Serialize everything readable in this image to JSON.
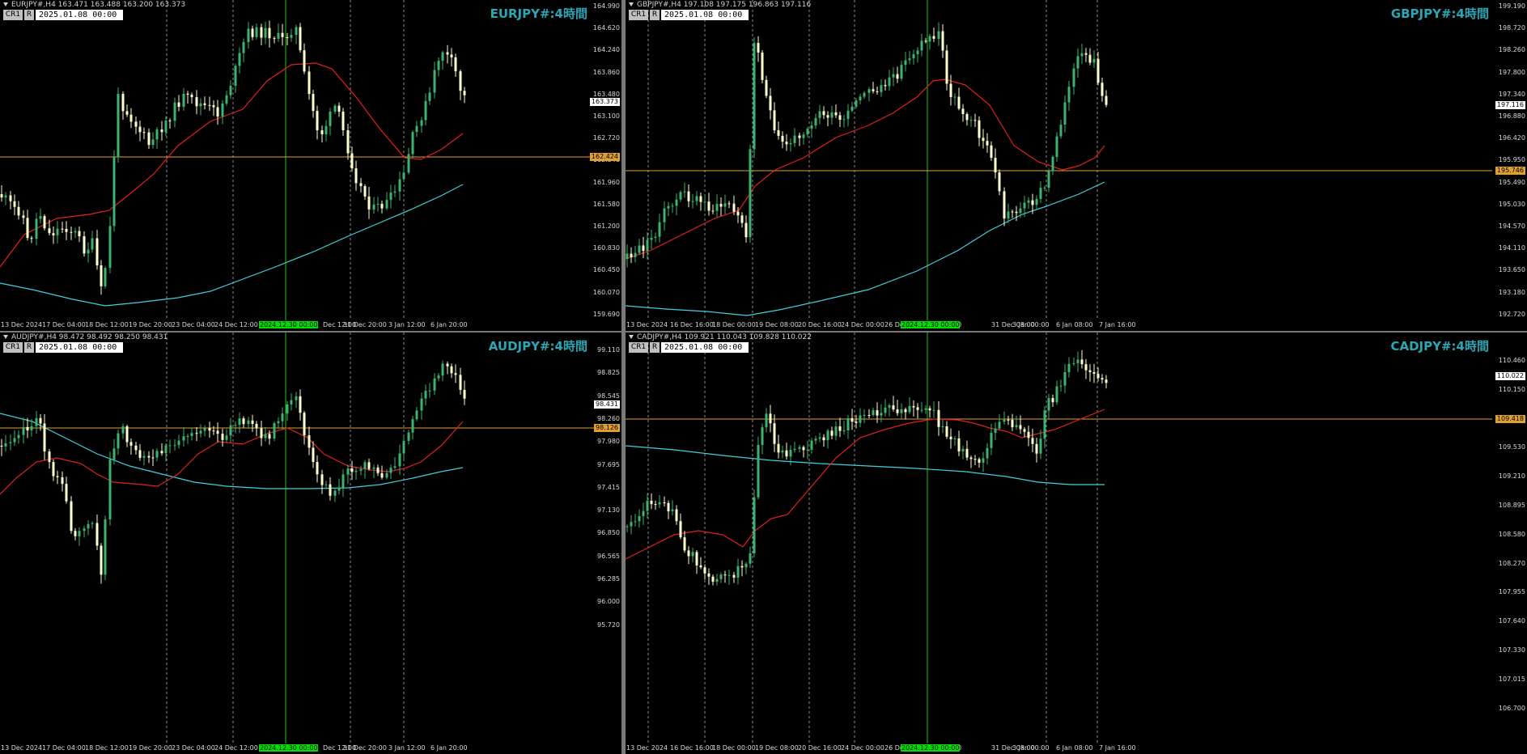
{
  "panes": [
    {
      "id": "eurjpy",
      "header": "EURJPY#,H4  163.471 163.488 163.200 163.373",
      "cr_label": "CR1",
      "r_label": "R",
      "cursor_date": "2025.01.08 00:00",
      "title": "EURJPY#:4時間",
      "prices": [
        "164.990",
        "164.620",
        "164.240",
        "163.860",
        "163.480",
        "163.100",
        "162.720",
        "162.340",
        "161.960",
        "161.580",
        "161.200",
        "160.830",
        "160.450",
        "160.070",
        "159.690"
      ],
      "current_price": "163.373",
      "hline_price": "162.424",
      "times": [
        "13 Dec 2024",
        "17 Dec 04:00",
        "18 Dec 12:00",
        "19 Dec 20:00",
        "23 Dec 04:00",
        "24 Dec 12:00",
        "Dec 12:00",
        "31 Dec 20:00",
        "3 Jan 12:00",
        "6 Jan 20:00"
      ],
      "time_marker": "2024.12.30 00:00"
    },
    {
      "id": "gbpjpy",
      "header": "GBPJPY#,H4  197.108 197.175 196.863 197.116",
      "cr_label": "CR1",
      "r_label": "R",
      "cursor_date": "2025.01.08 00:00",
      "title": "GBPJPY#:4時間",
      "prices": [
        "199.190",
        "198.720",
        "198.260",
        "197.800",
        "197.340",
        "196.880",
        "196.420",
        "195.950",
        "195.490",
        "195.030",
        "194.570",
        "194.110",
        "193.650",
        "193.180",
        "192.720"
      ],
      "current_price": "197.116",
      "hline_price": "195.746",
      "times": [
        "13 Dec 2024",
        "16 Dec 16:00",
        "18 Dec 00:00",
        "19 Dec 08:00",
        "20 Dec 16:00",
        "24 Dec 00:00",
        "26 De",
        "00",
        "31 Dec 08:00",
        "3 Jan 00:00",
        "6 Jan 08:00",
        "7 Jan 16:00"
      ],
      "time_marker": "2024.12.30 00:00"
    },
    {
      "id": "audjpy",
      "header": "AUDJPY#,H4  98.472 98.492 98.250 98.431",
      "cr_label": "CR1",
      "r_label": "R",
      "cursor_date": "2025.01.08 00:00",
      "title": "AUDJPY#:4時間",
      "prices": [
        "99.110",
        "98.825",
        "98.545",
        "98.260",
        "97.980",
        "97.695",
        "97.415",
        "97.130",
        "96.850",
        "96.565",
        "96.285",
        "96.000",
        "95.720"
      ],
      "current_price": "98.431",
      "hline_price": "98.126",
      "times": [
        "13 Dec 2024",
        "17 Dec 04:00",
        "18 Dec 12:00",
        "19 Dec 20:00",
        "23 Dec 04:00",
        "24 Dec 12:00",
        "Dec 12:00",
        "31 Dec 20:00",
        "3 Jan 12:00",
        "6 Jan 20:00"
      ],
      "time_marker": "2024.12.30 00:00"
    },
    {
      "id": "cadjpy",
      "header": "CADJPY#,H4  109.921 110.043 109.828 110.022",
      "cr_label": "CR1",
      "r_label": "R",
      "cursor_date": "2025.01.08 00:00",
      "title": "CADJPY#:4時間",
      "prices": [
        "110.460",
        "110.150",
        "109.845",
        "109.530",
        "109.210",
        "108.895",
        "108.580",
        "108.270",
        "107.955",
        "107.640",
        "107.330",
        "107.015",
        "106.700"
      ],
      "current_price": "110.022",
      "hline_price": "109.418",
      "times": [
        "13 Dec 2024",
        "16 Dec 16:00",
        "18 Dec 00:00",
        "19 Dec 08:00",
        "20 Dec 16:00",
        "24 Dec 00:00",
        "26 De",
        "00",
        "31 Dec 08:00",
        "3 Jan 00:00",
        "6 Jan 08:00",
        "7 Jan 16:00"
      ],
      "time_marker": "2024.12.30 00:00"
    }
  ],
  "colors": {
    "background": "#000000",
    "bull": "#3cb371",
    "bear": "#ffffcc",
    "ma_fast": "#e02020",
    "ma_slow": "#40d0e0",
    "hline": "#e0a030",
    "vline": "#20c020",
    "title": "#2aa6b5",
    "grid": "#c8c8c8"
  }
}
